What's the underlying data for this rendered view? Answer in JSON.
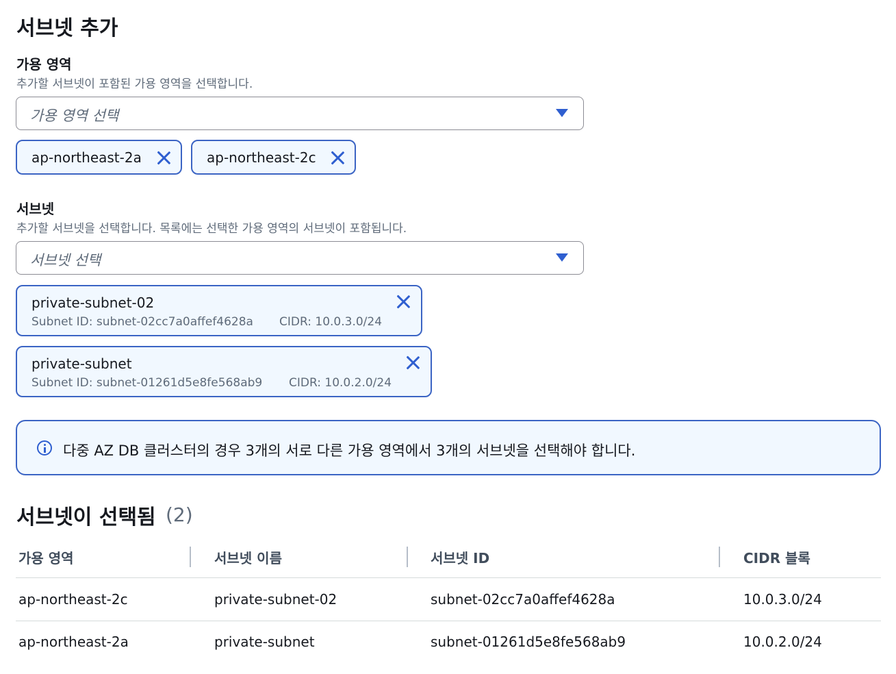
{
  "title": "서브넷 추가",
  "availability_zone": {
    "label": "가용 영역",
    "description": "추가할 서브넷이 포함된 가용 영역을 선택합니다.",
    "placeholder": "가용 영역 선택",
    "tokens": [
      "ap-northeast-2a",
      "ap-northeast-2c"
    ]
  },
  "subnet": {
    "label": "서브넷",
    "description": "추가할 서브넷을 선택합니다. 목록에는 선택한 가용 영역의 서브넷이 포함됩니다.",
    "placeholder": "서브넷 선택",
    "tokens": [
      {
        "name": "private-subnet-02",
        "subnet_id": "Subnet ID: subnet-02cc7a0affef4628a",
        "cidr": "CIDR: 10.0.3.0/24"
      },
      {
        "name": "private-subnet",
        "subnet_id": "Subnet ID: subnet-01261d5e8fe568ab9",
        "cidr": "CIDR: 10.0.2.0/24"
      }
    ]
  },
  "alert": {
    "text": "다중 AZ DB 클러스터의 경우 3개의 서로 다른 가용 영역에서 3개의 서브넷을 선택해야 합니다."
  },
  "selected": {
    "title": "서브넷이 선택됨",
    "count": "(2)",
    "columns": [
      "가용 영역",
      "서브넷 이름",
      "서브넷 ID",
      "CIDR 블록"
    ],
    "rows": [
      [
        "ap-northeast-2c",
        "private-subnet-02",
        "subnet-02cc7a0affef4628a",
        "10.0.3.0/24"
      ],
      [
        "ap-northeast-2a",
        "private-subnet",
        "subnet-01261d5e8fe568ab9",
        "10.0.2.0/24"
      ]
    ]
  },
  "colors": {
    "accent": "#2f5fd0",
    "token_border": "#3b64c4",
    "token_bg": "#f1f8ff"
  },
  "icons": {
    "dropdown": "caret-down-icon",
    "remove": "close-icon",
    "info": "info-icon"
  }
}
